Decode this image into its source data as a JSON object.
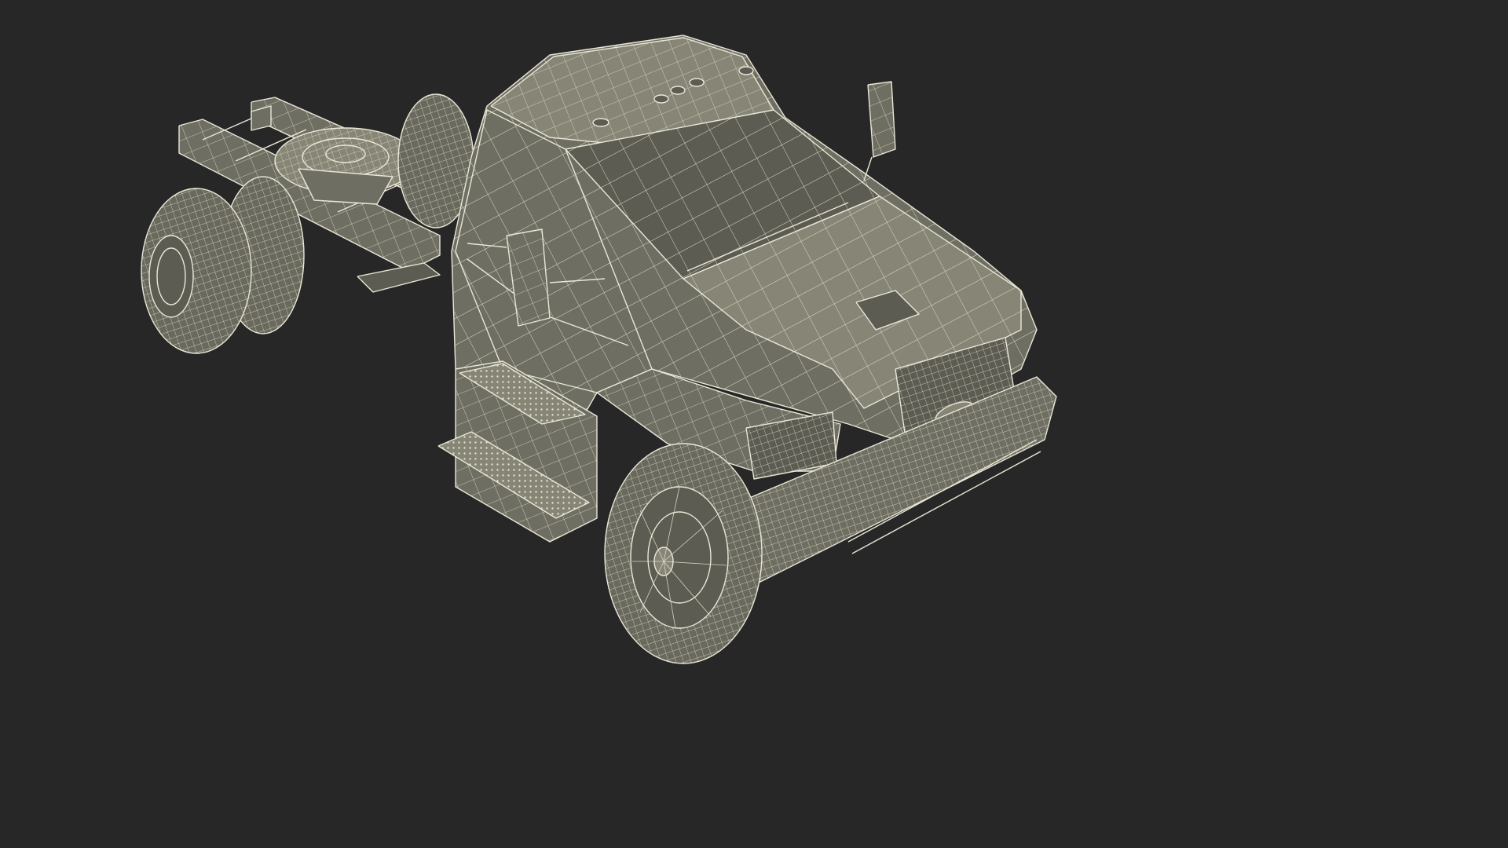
{
  "scene": {
    "background_color": "#272727",
    "wire_color": "#e9e7d6",
    "surface_color": "#6f6e62"
  }
}
